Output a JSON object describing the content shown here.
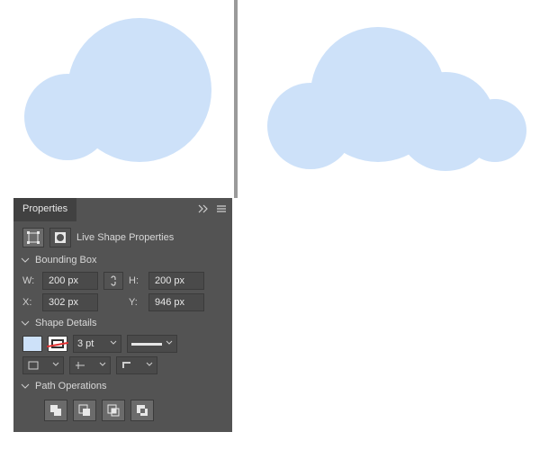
{
  "panel": {
    "title": "Properties",
    "shapeHeader": "Live Shape Properties",
    "sections": {
      "boundingBox": "Bounding Box",
      "shapeDetails": "Shape Details",
      "pathOperations": "Path Operations"
    },
    "labels": {
      "w": "W:",
      "h": "H:",
      "x": "X:",
      "y": "Y:"
    },
    "values": {
      "w": "200 px",
      "h": "200 px",
      "x": "302 px",
      "y": "946 px",
      "strokeWidth": "3 pt"
    },
    "colors": {
      "fill": "#cde1f9",
      "stroke": "none",
      "accent": "#cde1f9",
      "panelBg": "#535353"
    },
    "icons": {
      "boundingBox": "bounding-box-icon",
      "mask": "mask-icon",
      "link": "link-icon",
      "expand": "expand-icon",
      "menu": "menu-icon",
      "caret": "caret-down-icon",
      "alignEdges": "align-edges-icon",
      "alignCenter": "align-center-icon",
      "alignCorner": "align-corner-icon",
      "opUnite": "combine-icon",
      "opSubtract": "subtract-icon",
      "opIntersect": "intersect-icon",
      "opExclude": "exclude-icon"
    }
  }
}
